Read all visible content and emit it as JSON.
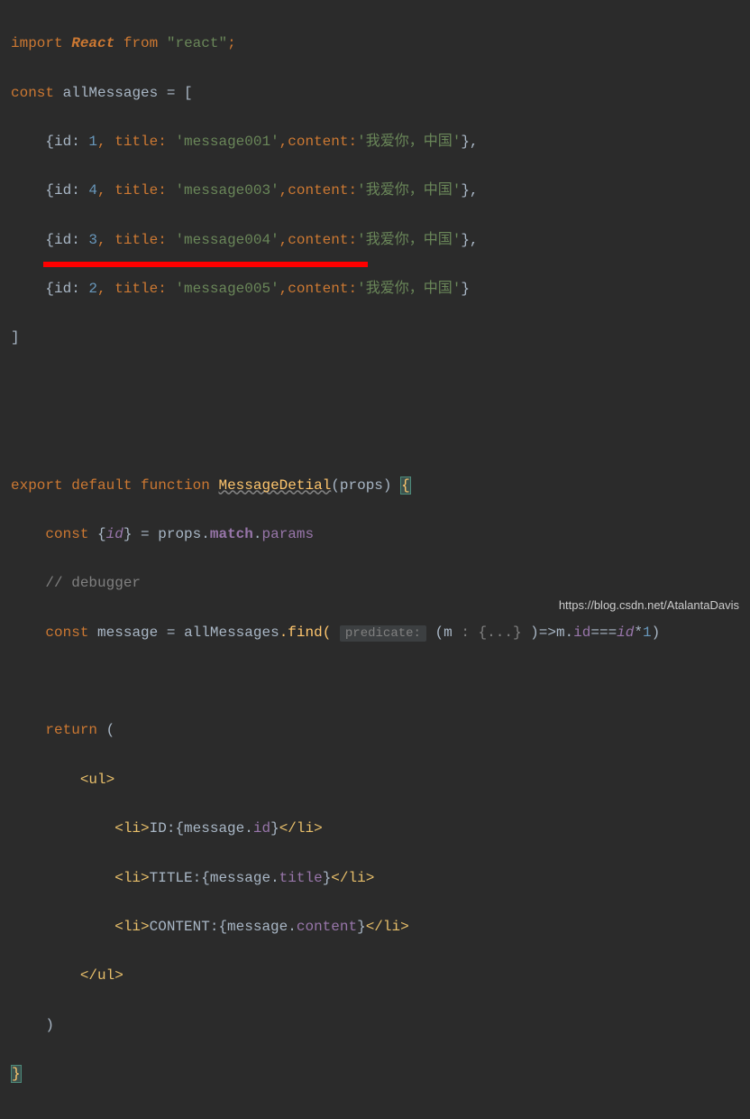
{
  "code": {
    "l1_import": "import",
    "l1_react": "React",
    "l1_from": "from",
    "l1_str": "\"react\"",
    "l1_semi": ";",
    "l2_const": "const",
    "l2_var": "allMessages",
    "l2_eq": " = [",
    "l3": "    {id: ",
    "l3_n": "1",
    "l3_b": ", title: ",
    "l3_s1": "'message001'",
    "l3_c": ",content:",
    "l3_s2": "'我爱你，中国'",
    "l3_e": "},",
    "l4": "    {id: ",
    "l4_n": "4",
    "l4_b": ", title: ",
    "l4_s1": "'message003'",
    "l4_c": ",content:",
    "l4_s2": "'我爱你，中国'",
    "l4_e": "},",
    "l5": "    {id: ",
    "l5_n": "3",
    "l5_b": ", title: ",
    "l5_s1": "'message004'",
    "l5_c": ",content:",
    "l5_s2": "'我爱你，中国'",
    "l5_e": "},",
    "l6": "    {id: ",
    "l6_n": "2",
    "l6_b": ", title: ",
    "l6_s1": "'message005'",
    "l6_c": ",content:",
    "l6_s2": "'我爱你，中国'",
    "l6_e": "}",
    "l7": "]",
    "l10_export": "export",
    "l10_default": "default",
    "l10_function": "function",
    "l10_fname": "MessageDetial",
    "l10_args": "(props) ",
    "l10_brace": "{",
    "l11_const": "const",
    "l11_a": " {",
    "l11_id": "id",
    "l11_b": "} = ",
    "l11_props": "props",
    "l11_dot1": ".",
    "l11_match": "match",
    "l11_dot2": ".",
    "l11_params": "params",
    "l12": "    // debugger",
    "l13_const": "const",
    "l13_msg": "message",
    "l13_eq": " = ",
    "l13_all": "allMessages",
    "l13_find": ".find( ",
    "l13_hint": "predicate:",
    "l13_arrow": " (m ",
    "l13_type": ": {...}",
    "l13_ar2": " )=>m.",
    "l13_id": "id",
    "l13_op": "===",
    "l13_id2": "id",
    "l13_mul": "*",
    "l13_one": "1",
    "l13_end": ")",
    "l15_return": "return",
    "l15_p": " (",
    "l16_ul_o": "<ul>",
    "l17_li_o": "<li>",
    "l17_t": "ID:",
    "l17_jb": "{",
    "l17_m": "message",
    "l17_d": ".",
    "l17_p": "id",
    "l17_je": "}",
    "l17_li_c": "</li>",
    "l18_li_o": "<li>",
    "l18_t": "TITLE:",
    "l18_jb": "{",
    "l18_m": "message",
    "l18_d": ".",
    "l18_p": "title",
    "l18_je": "}",
    "l18_li_c": "</li>",
    "l19_li_o": "<li>",
    "l19_t": "CONTENT:",
    "l19_jb": "{",
    "l19_m": "message",
    "l19_d": ".",
    "l19_p": "content",
    "l19_je": "}",
    "l19_li_c": "</li>",
    "l20_ul_c": "</ul>",
    "l21": "    )",
    "l22": "}"
  },
  "watermark": "https://blog.csdn.net/AtalantaDavis"
}
